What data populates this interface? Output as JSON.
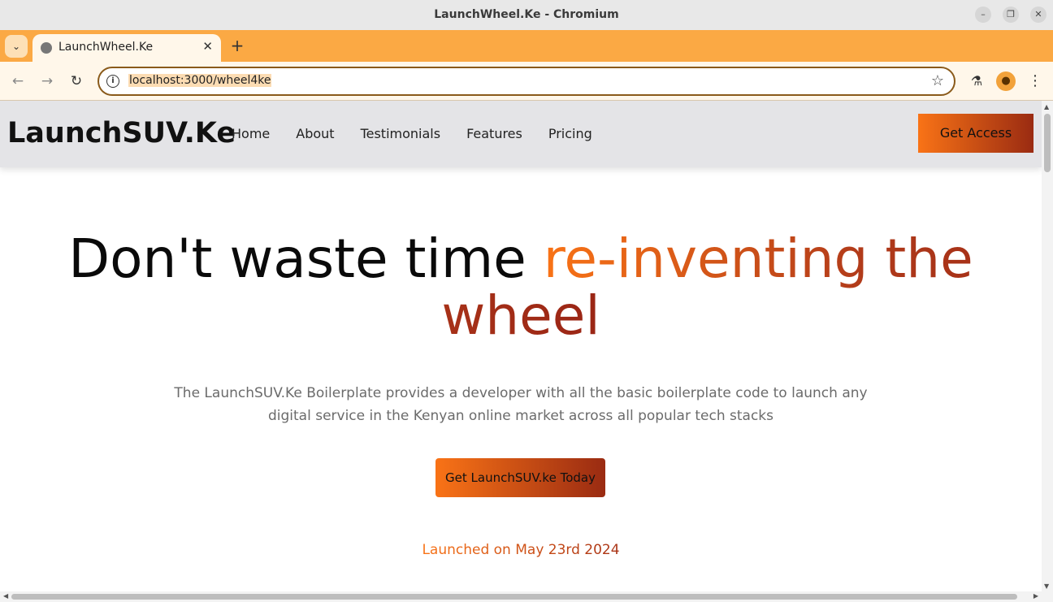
{
  "window": {
    "title": "LaunchWheel.Ke - Chromium",
    "controls": {
      "minimize": "–",
      "maximize": "❐",
      "close": "✕"
    }
  },
  "tabs": [
    {
      "label": "LaunchWheel.Ke",
      "active": true,
      "close": "✕"
    }
  ],
  "tab_controls": {
    "menu": "⌄",
    "new_tab": "+"
  },
  "toolbar": {
    "back": "←",
    "forward": "→",
    "reload": "↻",
    "info": "i",
    "url": "localhost:3000/wheel4ke",
    "bookmark": "☆",
    "labs": "⚗",
    "profile": "●",
    "menu": "⋮"
  },
  "site": {
    "logo": "LaunchSUV.Ke",
    "nav": [
      "Home",
      "About",
      "Testimonials",
      "Features",
      "Pricing"
    ],
    "nav_cta": "Get Access",
    "hero": {
      "title_plain": "Don't waste time ",
      "title_accent": "re-inventing the wheel",
      "subtitle": "The LaunchSUV.Ke Boilerplate provides a developer with all the basic boilerplate code to launch any digital service in the Kenyan online market across all popular tech stacks",
      "cta": "Get LaunchSUV.ke Today",
      "launched": "Launched on May 23rd 2024"
    }
  },
  "scrollbars": {
    "up": "▲",
    "down": "▼",
    "left": "◀",
    "right": "▶"
  },
  "colors": {
    "accent_start": "#f97316",
    "accent_end": "#9a2b12",
    "tabstrip": "#fba944",
    "nav_bg": "#e4e4e7"
  }
}
